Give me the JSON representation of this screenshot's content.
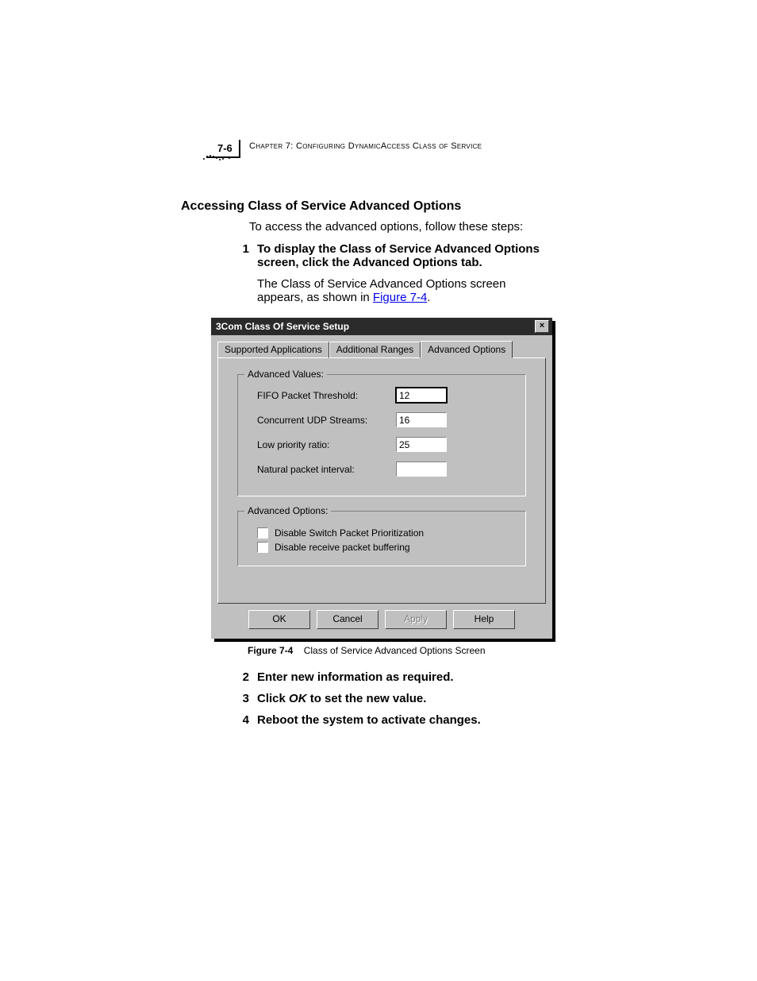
{
  "header": {
    "page_number": "7-6",
    "running_head": "Chapter 7: Configuring DynamicAccess Class of Service"
  },
  "section": {
    "title": "Accessing Class of Service Advanced Options",
    "intro": "To access the advanced options, follow these steps:"
  },
  "step1": {
    "num": "1",
    "text": "To display the Class of Service Advanced Options screen, click the Advanced Options tab.",
    "body_pre": "The Class of Service Advanced Options screen appears, as shown in ",
    "fig_link": "Figure 7-4",
    "body_post": "."
  },
  "dialog": {
    "title": "3Com Class Of Service Setup",
    "close": "×",
    "tabs": {
      "t1": "Supported Applications",
      "t2": "Additional Ranges",
      "t3": "Advanced Options"
    },
    "values_group": {
      "legend": "Advanced Values:",
      "fifo_label": "FIFO Packet Threshold:",
      "fifo_value": "12",
      "udp_label": "Concurrent UDP Streams:",
      "udp_value": "16",
      "ratio_label": "Low priority ratio:",
      "ratio_value": "25",
      "interval_label": "Natural packet interval:",
      "interval_value": ""
    },
    "options_group": {
      "legend": "Advanced Options:",
      "opt1": "Disable Switch Packet Prioritization",
      "opt2": "Disable receive packet buffering"
    },
    "buttons": {
      "ok": "OK",
      "cancel": "Cancel",
      "apply": "Apply",
      "help": "Help"
    }
  },
  "figure": {
    "label": "Figure 7-4",
    "caption": "Class of Service Advanced Options Screen"
  },
  "step2": {
    "num": "2",
    "text": "Enter new information as required."
  },
  "step3": {
    "num": "3",
    "pre": "Click ",
    "ok": "OK",
    "post": " to set the new value."
  },
  "step4": {
    "num": "4",
    "text": "Reboot the system to activate changes."
  }
}
